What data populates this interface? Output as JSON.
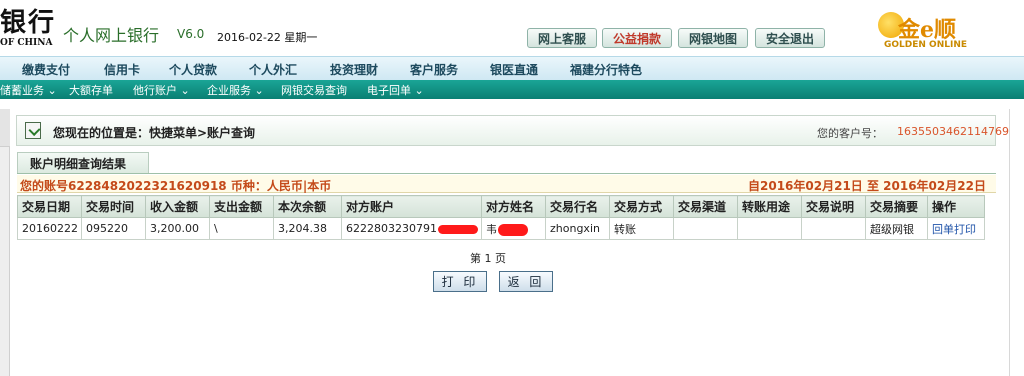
{
  "header": {
    "logo_text": "银行",
    "logo_sub": "OF CHINA",
    "site_title": "个人网上银行",
    "version": "V6.0",
    "date": "2016-02-22 星期一",
    "buttons": [
      "网上客服",
      "公益捐款",
      "网银地图",
      "安全退出"
    ],
    "brand_cn": "金e顺",
    "brand_en": "GOLDEN ONLINE"
  },
  "nav_primary": [
    "缴费支付",
    "信用卡",
    "个人贷款",
    "个人外汇",
    "投资理财",
    "客户服务",
    "银医直通",
    "福建分行特色"
  ],
  "nav_secondary": [
    "储蓄业务 ⌄",
    "大额存单",
    "他行账户 ⌄",
    "企业服务 ⌄",
    "网银交易查询",
    "电子回单 ⌄"
  ],
  "breadcrumb": {
    "text": "您现在的位置是：快捷菜单>账户查询",
    "customer_label": "您的客户号：",
    "customer_no": "1635503462114769"
  },
  "panel": {
    "tab_title": "账户明细查询结果",
    "account_info": "您的账号6228482022321620918 币种：人民币|本币",
    "date_range": "自2016年02月21日  至  2016年02月22日"
  },
  "table": {
    "headers": [
      "交易日期",
      "交易时间",
      "收入金额",
      "支出金额",
      "本次余额",
      "对方账户",
      "对方姓名",
      "交易行名",
      "交易方式",
      "交易渠道",
      "转账用途",
      "交易说明",
      "交易摘要",
      "操作"
    ],
    "rows": [
      {
        "date": "20160222",
        "time": "095220",
        "income": "3,200.00",
        "expense": "\\",
        "balance": "3,204.38",
        "counter_account": "6222803230791",
        "counter_name": "韦",
        "bank_name": "zhongxin",
        "method": "转账",
        "channel": "",
        "purpose": "",
        "note": "",
        "summary": "超级网银",
        "action": "回单打印"
      }
    ]
  },
  "pager": "第 1 页",
  "actions": {
    "print": "打 印",
    "back": "返 回"
  },
  "colors": {
    "accent_red": "#c44a1a",
    "nav_teal": "#0a7f73",
    "customer_no": "#d9542a"
  }
}
